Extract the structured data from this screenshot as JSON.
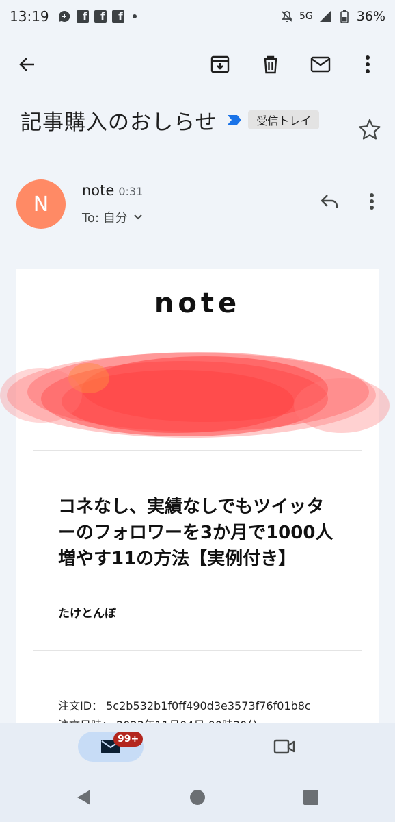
{
  "status_bar": {
    "time": "13:19",
    "network": "5G",
    "battery": "36%"
  },
  "toolbar": {
    "back_icon": "arrow-left-icon",
    "archive_icon": "archive-icon",
    "delete_icon": "trash-icon",
    "mark_unread_icon": "envelope-icon",
    "more_icon": "more-vertical-icon"
  },
  "email": {
    "subject": "記事購入のおしらせ",
    "label": "受信トレイ",
    "sender_initial": "N",
    "sender": "note",
    "time": "0:31",
    "recipient": "To: 自分"
  },
  "content": {
    "brand": "note",
    "article_title": "コネなし、実績なしでもツイッターのフォロワーを3か月で1000人増やす11の方法【実例付き】",
    "author": "たけとんぼ",
    "order_id_line": "注文ID： 5c2b532b1f0ff490d3e3573f76f01b8c",
    "order_date_line": "注文日時： 2023年11月04日 00時30分"
  },
  "bottom_nav": {
    "mail_badge": "99+"
  },
  "colors": {
    "background": "#f0f4f9",
    "avatar": "#ff8a65",
    "badge": "#b3261e",
    "mail_pill": "#c7dcf6",
    "redaction": "#ff4d4d",
    "importance": "#1a73e8"
  }
}
